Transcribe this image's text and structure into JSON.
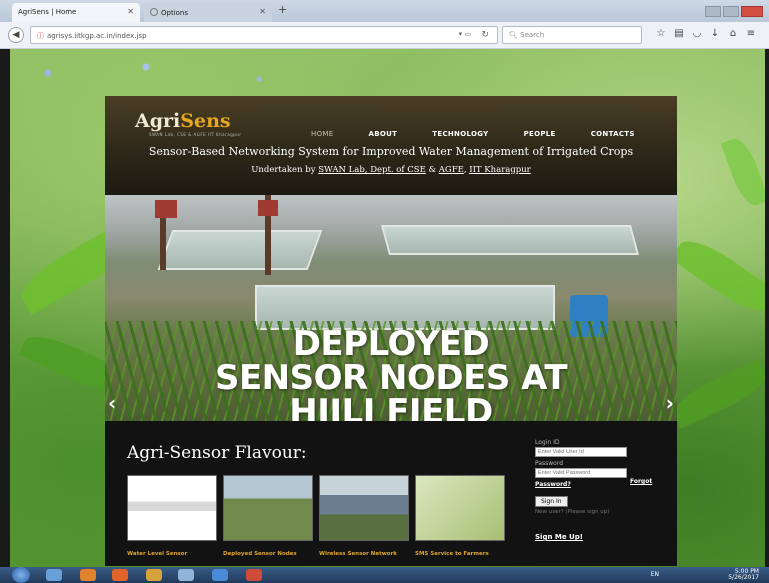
{
  "browser": {
    "tabs": [
      {
        "title": "AgriSens | Home",
        "active": true
      },
      {
        "title": "Options",
        "active": false
      }
    ],
    "new_tab": "+",
    "url": "agrisys.iitkgp.ac.in/index.jsp",
    "search_placeholder": "Search",
    "icons": [
      "star-icon",
      "reading-list-icon",
      "pocket-icon",
      "download-icon",
      "home-icon",
      "menu-icon"
    ]
  },
  "site": {
    "logo_prefix": "Agri",
    "logo_accent": "Sens",
    "logo_subtitle": "SWAN Lab, CSE & AGFE\nIIT Kharagpur",
    "menu": [
      "HOME",
      "ABOUT",
      "TECHNOLOGY",
      "PEOPLE",
      "CONTACTS"
    ],
    "tagline": "Sensor-Based Networking System for Improved Water Management of Irrigated Crops",
    "undertaken_prefix": "Undertaken by ",
    "undertaken_swan": "SWAN Lab, Dept. of CSE",
    "undertaken_amp": " & ",
    "undertaken_agfe": "AGFE",
    "undertaken_comma": ", ",
    "undertaken_iit": "IIT Kharagpur",
    "slide_lines": [
      "DEPLOYED",
      "SENSOR NODES AT",
      "HIJLI FIELD"
    ],
    "prev_arrow": "‹",
    "next_arrow": "›",
    "flavour_title": "Agri-Sensor Flavour:",
    "flavours": [
      {
        "caption": "Water Level Sensor"
      },
      {
        "caption": "Deployed Sensor Nodes"
      },
      {
        "caption": "Wireless Sensor Network"
      },
      {
        "caption": "SMS Service to Farmers"
      }
    ],
    "login": {
      "login_label": "Login ID",
      "login_placeholder": "Enter Valid User Id",
      "password_label": "Password",
      "password_placeholder": "Enter Valid Password",
      "forgot_1": "Forgot",
      "forgot_2": "Password?",
      "sign_in": "Sign In",
      "new_user": "New user? (Please sign up)",
      "sign_me_up": "Sign Me Up!"
    }
  },
  "taskbar": {
    "lang": "EN",
    "time": "5:00 PM",
    "date": "5/26/2017"
  },
  "colors": {
    "accent": "#e8a81e",
    "caption": "#e0a632",
    "header_bg": "#2b2617"
  }
}
